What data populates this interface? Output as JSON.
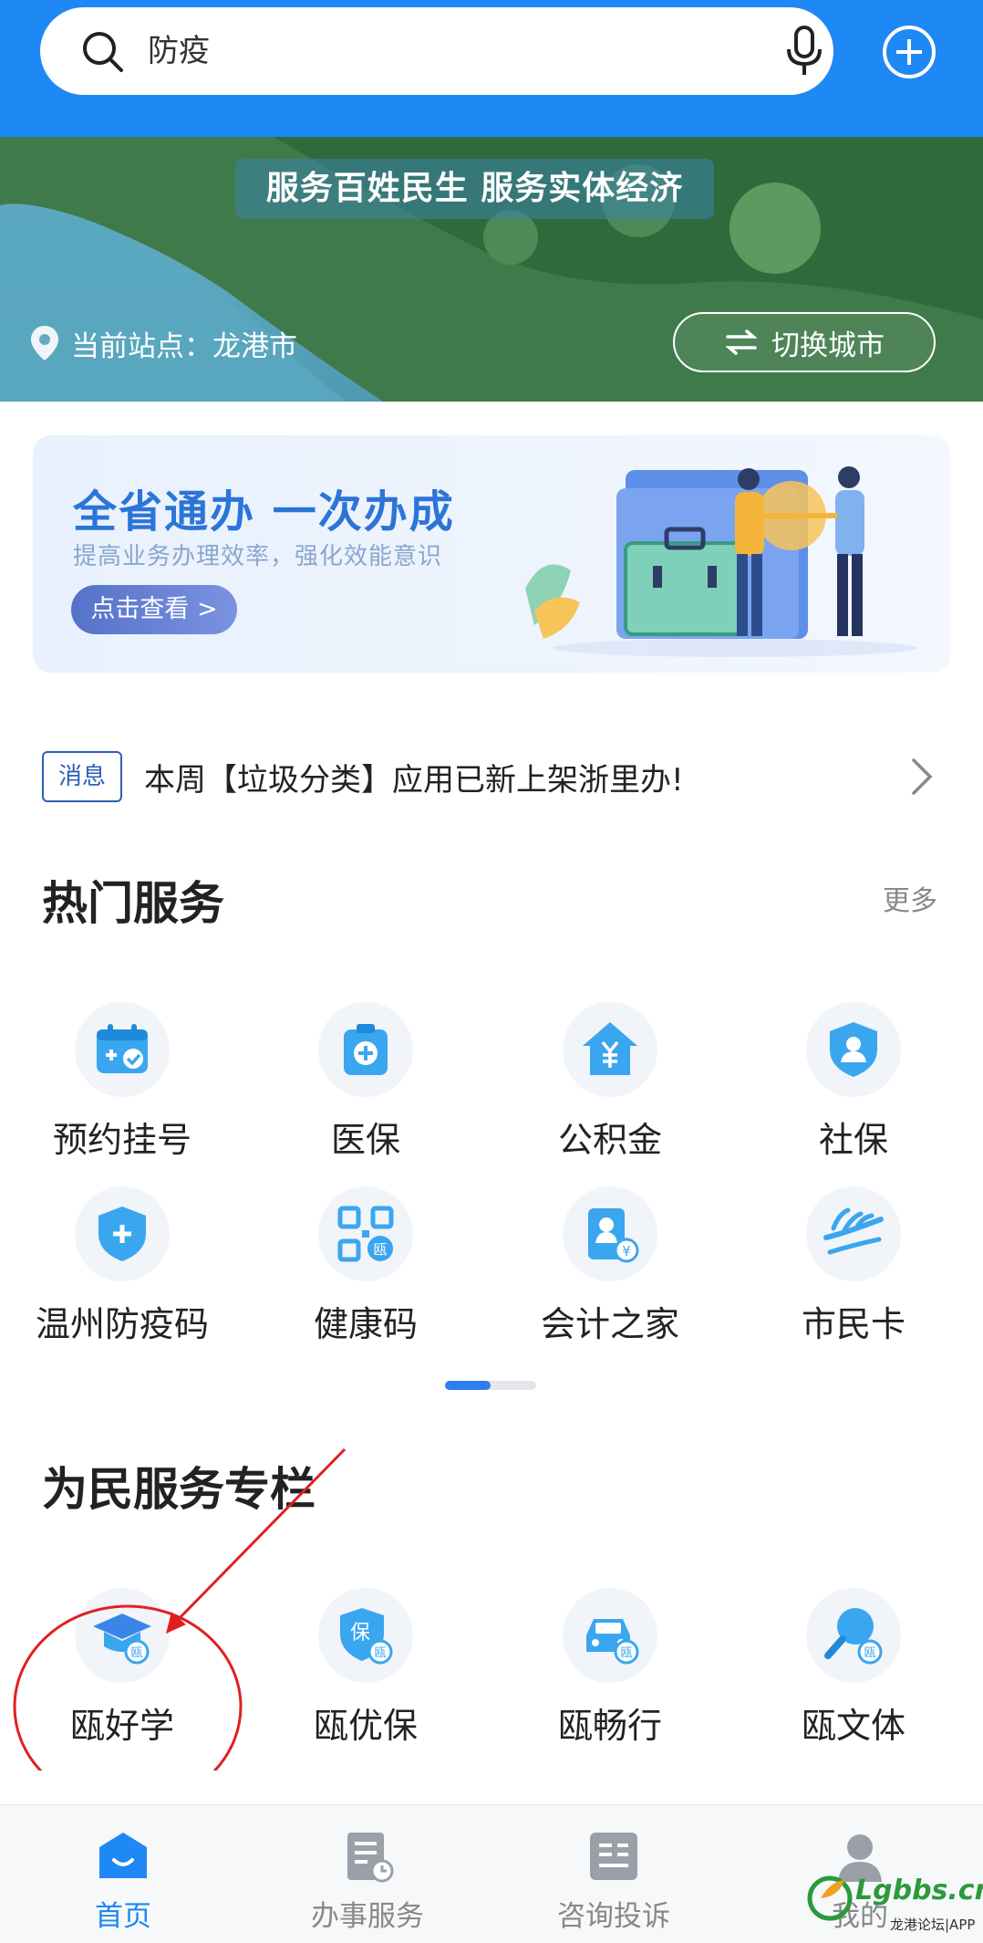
{
  "search": {
    "query": "防疫"
  },
  "banner": {
    "slogan": "服务百姓民生  服务实体经济",
    "location_label": "当前站点：龙港市",
    "switch_city_label": "切换城市"
  },
  "promo": {
    "title": "全省通办 一次办成",
    "subtitle": "提高业务办理效率，强化效能意识",
    "button_label": "点击查看 >"
  },
  "notice": {
    "badge": "消息",
    "text": "本周【垃圾分类】应用已新上架浙里办!"
  },
  "hot_services": {
    "title": "热门服务",
    "more": "更多",
    "items": [
      {
        "label": "预约挂号",
        "icon": "calendar-check-icon"
      },
      {
        "label": "医保",
        "icon": "medical-insurance-icon"
      },
      {
        "label": "公积金",
        "icon": "housing-fund-icon"
      },
      {
        "label": "社保",
        "icon": "social-security-icon"
      },
      {
        "label": "温州防疫码",
        "icon": "epidemic-code-icon"
      },
      {
        "label": "健康码",
        "icon": "health-code-icon"
      },
      {
        "label": "会计之家",
        "icon": "accountant-icon"
      },
      {
        "label": "市民卡",
        "icon": "citizen-card-icon"
      }
    ]
  },
  "people_services": {
    "title": "为民服务专栏",
    "items": [
      {
        "label": "瓯好学",
        "icon": "graduation-cap-icon"
      },
      {
        "label": "瓯优保",
        "icon": "insurance-shield-icon"
      },
      {
        "label": "瓯畅行",
        "icon": "car-icon"
      },
      {
        "label": "瓯文体",
        "icon": "ping-pong-icon"
      }
    ]
  },
  "icon_badge_char": "瓯",
  "bottom_nav": [
    {
      "label": "首页",
      "icon": "home-icon",
      "active": true
    },
    {
      "label": "办事服务",
      "icon": "document-clock-icon",
      "active": false
    },
    {
      "label": "咨询投诉",
      "icon": "complaint-icon",
      "active": false
    },
    {
      "label": "我的",
      "icon": "user-icon",
      "active": false
    }
  ],
  "watermark": {
    "text": "Lgbbs.cn",
    "sub": "龙港论坛|APP"
  },
  "colors": {
    "primary": "#1e88f5",
    "icon_blue": "#3aa6f0",
    "annotation_red": "#e02020"
  }
}
